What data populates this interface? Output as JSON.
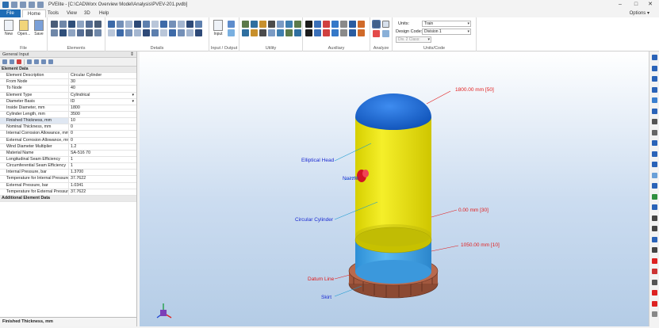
{
  "window": {
    "title": "PVElite - [C:\\CADWorx Overview Model\\Analysis\\PVEV-201.pvdb]"
  },
  "tabs": [
    {
      "label": "File"
    },
    {
      "label": "Home"
    },
    {
      "label": "Tools"
    },
    {
      "label": "View"
    },
    {
      "label": "3D"
    },
    {
      "label": "Help"
    }
  ],
  "options_label": "Options",
  "ribbon": {
    "new_label": "New",
    "open_label": "Open...",
    "save_label": "Save",
    "input_label": "Input",
    "groups": {
      "file": "File",
      "elements": "Elements",
      "details": "Details",
      "input_output": "Input / Output",
      "utility": "Utility",
      "auxiliary": "Auxiliary",
      "analyze": "Analyze",
      "units_code": "Units/Code"
    },
    "units_label": "Units:",
    "units_value": "Train",
    "design_code_label": "Design Code:",
    "design_code_value": "Division 1",
    "div2_value": "Div. 2 Class:"
  },
  "panel": {
    "title": "General Input",
    "pin": "⇕",
    "rows": [
      {
        "label": "Element Data",
        "value": "",
        "cat": true
      },
      {
        "label": "Element Description",
        "value": "Circular Cylinder"
      },
      {
        "label": "From Node",
        "value": "30"
      },
      {
        "label": "To Node",
        "value": "40"
      },
      {
        "label": "Element Type",
        "value": "Cylindrical",
        "dd": true
      },
      {
        "label": "Diameter Basis",
        "value": "ID",
        "dd": true
      },
      {
        "label": "Inside Diameter, mm",
        "value": "1800"
      },
      {
        "label": "Cylinder Length, mm",
        "value": "3500"
      },
      {
        "label": "Finished Thickness, mm",
        "value": "10",
        "sel": true
      },
      {
        "label": "Nominal Thickness, mm",
        "value": "0"
      },
      {
        "label": "Internal Corrosion Allowance, mm",
        "value": "0"
      },
      {
        "label": "External Corrosion Allowance, mm",
        "value": "0"
      },
      {
        "label": "Wind Diameter Multiplier",
        "value": "1.2"
      },
      {
        "label": "Material Name",
        "value": "SA-516 70"
      },
      {
        "label": "Longitudinal Seam Efficiency",
        "value": "1"
      },
      {
        "label": "Circumferential Seam Efficiency",
        "value": "1"
      },
      {
        "label": "Internal Pressure, bar",
        "value": "1.3700"
      },
      {
        "label": "Temperature for Internal Pressure,",
        "value": "37.7622"
      },
      {
        "label": "External Pressure, bar",
        "value": "1.0341"
      },
      {
        "label": "Temperature for External Pressure,",
        "value": "37.7622"
      },
      {
        "label": "Additional Element Data",
        "value": "",
        "cat": true
      }
    ],
    "description": "Finished Thickness, mm"
  },
  "viewport": {
    "labels": {
      "top_dim": "1800.00 mm [50]",
      "elliptical_head": "Elliptical Head",
      "nozzle": "Nozzle",
      "circular_cylinder": "Circular Cylinder",
      "dim_0": "0.00 mm [30]",
      "dim_1050": "1050.00 mm [10]",
      "datum_line": "Datum Line",
      "skirt": "Skirt"
    },
    "colors": {
      "head": "#1f6fd8",
      "cylinder": "#f1ea10",
      "skirt": "#3aa0e6",
      "base_ring": "#a2583e",
      "nozzle": "#e0192a",
      "label_blue": "#1b2ad1",
      "label_red": "#e21b1b"
    }
  }
}
